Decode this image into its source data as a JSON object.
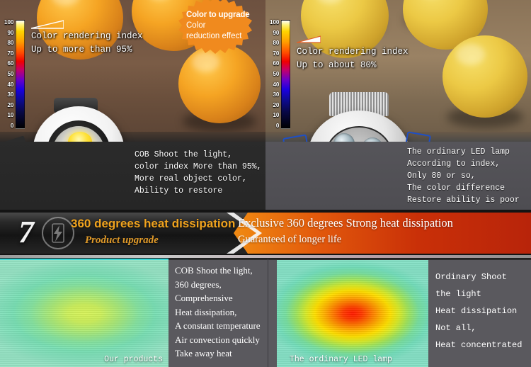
{
  "comparison": {
    "left": {
      "cri_scale": {
        "ticks": [
          "100",
          "90",
          "80",
          "70",
          "60",
          "50",
          "40",
          "30",
          "20",
          "10",
          "0"
        ],
        "marker_icon": "wedge-marker-icon",
        "marker_level": 100
      },
      "headline": "Color rendering index",
      "subline": "Up to more than 95%",
      "badge": {
        "title": "Color to upgrade",
        "line2": "Color",
        "line3": "reduction effect",
        "color": "#f08a1e",
        "icon": "starburst-badge-icon"
      },
      "product_icon": "cob-downlight-icon",
      "caption": [
        "COB Shoot the light,",
        "color index More than 95%,",
        "More real object color,",
        "Ability to restore"
      ]
    },
    "right": {
      "cri_scale": {
        "ticks": [
          "100",
          "90",
          "80",
          "70",
          "60",
          "50",
          "40",
          "30",
          "20",
          "10",
          "0"
        ],
        "marker_icon": "wedge-marker-icon",
        "marker_level": 80
      },
      "headline": "Color rendering index",
      "subline": "Up to about 80%",
      "product_icon": "three-led-downlight-icon",
      "caption": [
        "The ordinary LED lamp",
        "According to index,",
        "Only 80 or so,",
        "The color difference",
        "Restore ability is poor"
      ]
    }
  },
  "banner": {
    "number": "7",
    "logo_icon": "lightning-bolt-circle-icon",
    "title": "360 degrees heat dissipation",
    "subtitle": "Product upgrade",
    "right_line1": "Exclusive 360 degrees Strong heat dissipation",
    "right_line2": "Guaranteed of longer life",
    "accent_color": "#f0a31e",
    "hot_color": "#e2590c"
  },
  "thermal": {
    "left": {
      "image_label": "Our products",
      "image_icon": "thermal-map-even-icon",
      "text": [
        "COB Shoot the light,",
        "360 degrees,",
        "Comprehensive",
        "Heat dissipation,",
        "A constant temperature",
        "Air convection quickly",
        "Take away heat"
      ]
    },
    "right": {
      "image_label": "The ordinary LED lamp",
      "image_icon": "thermal-map-hotspot-icon",
      "text": [
        "Ordinary Shoot",
        "the light",
        "Heat dissipation",
        "Not all,",
        "Heat concentrated"
      ]
    }
  }
}
